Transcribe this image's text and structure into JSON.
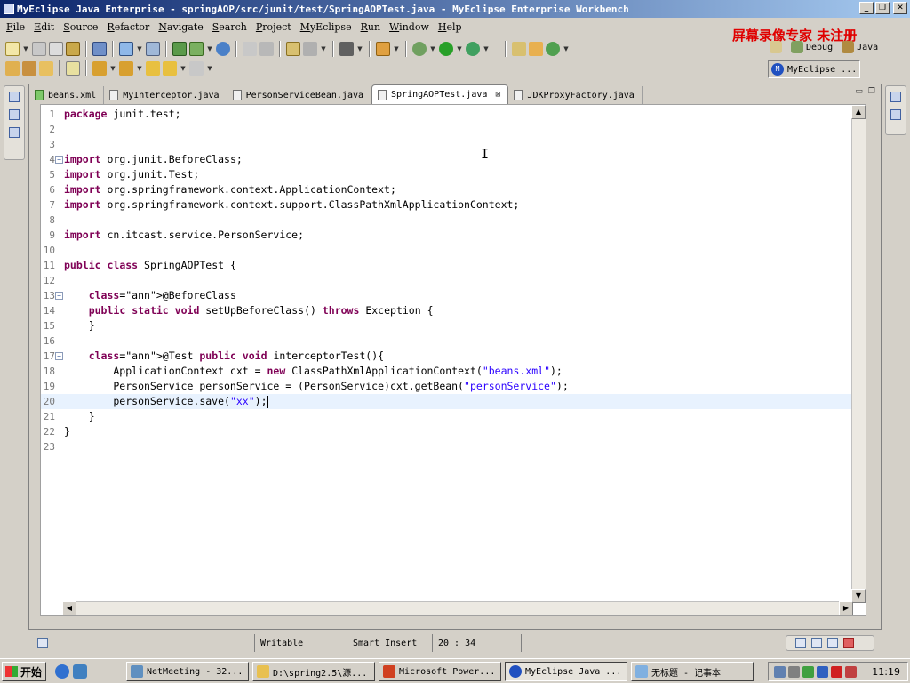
{
  "window": {
    "title": "MyEclipse Java Enterprise - springAOP/src/junit/test/SpringAOPTest.java - MyEclipse Enterprise Workbench",
    "minimize": "_",
    "maximize": "❐",
    "close": "✕"
  },
  "menu": [
    "File",
    "Edit",
    "Source",
    "Refactor",
    "Navigate",
    "Search",
    "Project",
    "MyEclipse",
    "Run",
    "Window",
    "Help"
  ],
  "watermark": "屏幕录像专家 未注册",
  "perspectives": {
    "debug": "Debug",
    "java": "Java",
    "myeclipse": "MyEclipse ..."
  },
  "tabs": [
    {
      "label": "beans.xml",
      "active": false
    },
    {
      "label": "MyInterceptor.java",
      "active": false
    },
    {
      "label": "PersonServiceBean.java",
      "active": false
    },
    {
      "label": "SpringAOPTest.java",
      "active": true
    },
    {
      "label": "JDKProxyFactory.java",
      "active": false
    }
  ],
  "code_lines": [
    {
      "n": "1",
      "t": "package junit.test;"
    },
    {
      "n": "2",
      "t": ""
    },
    {
      "n": "3",
      "t": ""
    },
    {
      "n": "4",
      "t": "import org.junit.BeforeClass;"
    },
    {
      "n": "5",
      "t": "import org.junit.Test;"
    },
    {
      "n": "6",
      "t": "import org.springframework.context.ApplicationContext;"
    },
    {
      "n": "7",
      "t": "import org.springframework.context.support.ClassPathXmlApplicationContext;"
    },
    {
      "n": "8",
      "t": ""
    },
    {
      "n": "9",
      "t": "import cn.itcast.service.PersonService;"
    },
    {
      "n": "10",
      "t": ""
    },
    {
      "n": "11",
      "t": "public class SpringAOPTest {"
    },
    {
      "n": "12",
      "t": ""
    },
    {
      "n": "13",
      "t": "    @BeforeClass"
    },
    {
      "n": "14",
      "t": "    public static void setUpBeforeClass() throws Exception {"
    },
    {
      "n": "15",
      "t": "    }"
    },
    {
      "n": "16",
      "t": ""
    },
    {
      "n": "17",
      "t": "    @Test public void interceptorTest(){"
    },
    {
      "n": "18",
      "t": "        ApplicationContext cxt = new ClassPathXmlApplicationContext(\"beans.xml\");"
    },
    {
      "n": "19",
      "t": "        PersonService personService = (PersonService)cxt.getBean(\"personService\");"
    },
    {
      "n": "20",
      "t": "        personService.save(\"xx\");"
    },
    {
      "n": "21",
      "t": "    }"
    },
    {
      "n": "22",
      "t": "}"
    },
    {
      "n": "23",
      "t": ""
    }
  ],
  "status": {
    "writable": "Writable",
    "insert_mode": "Smart Insert",
    "position": "20 : 34"
  },
  "taskbar": {
    "start": "开始",
    "tasks": [
      {
        "label": "NetMeeting - 32..."
      },
      {
        "label": "D:\\spring2.5\\源..."
      },
      {
        "label": "Microsoft Power..."
      },
      {
        "label": "MyEclipse Java ..."
      },
      {
        "label": "无标题 - 记事本"
      }
    ],
    "clock": "11:19"
  }
}
